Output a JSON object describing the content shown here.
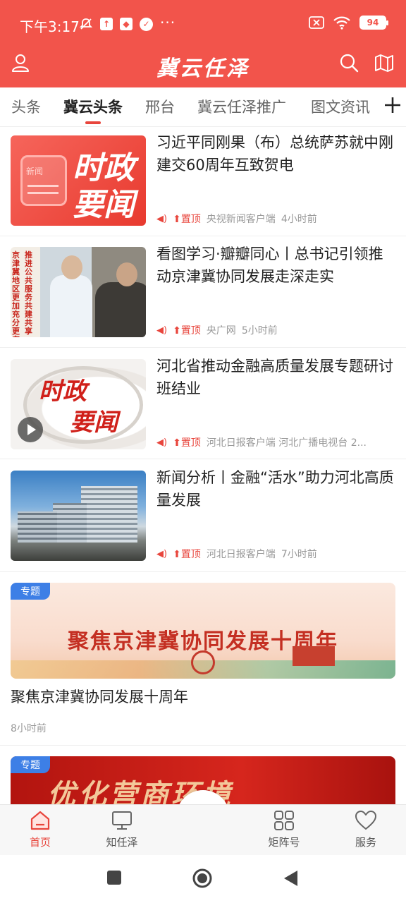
{
  "status_bar": {
    "time": "下午3:17",
    "battery": "94"
  },
  "header": {
    "title": "冀云任泽"
  },
  "tabs": [
    {
      "label": "头条"
    },
    {
      "label": "冀云头条"
    },
    {
      "label": "邢台"
    },
    {
      "label": "冀云任泽推广"
    },
    {
      "label": "图文资讯"
    }
  ],
  "news": [
    {
      "title": "习近平同刚果（布）总统萨苏就中刚建交60周年互致贺电",
      "pin": "置顶",
      "source": "央视新闻客户端",
      "time": "4小时前",
      "thumb_badge": "新闻",
      "thumb_text_1": "时政",
      "thumb_text_2": "要闻"
    },
    {
      "title": "看图学习·瓣瓣同心丨总书记引领推动京津冀协同发展走深走实",
      "pin": "置顶",
      "source": "央广网",
      "time": "5小时前",
      "thumb_side_text_1": "推进公共服务共建共享",
      "thumb_side_text_2": "京津冀地区更加充分更高"
    },
    {
      "title": "河北省推动金融高质量发展专题研讨班结业",
      "pin": "置顶",
      "source": "河北日报客户端 河北广播电视台  2...",
      "time": "",
      "thumb_text_1": "时政",
      "thumb_text_2": "要闻"
    },
    {
      "title": "新闻分析丨金融“活水”助力河北高质量发展",
      "pin": "置顶",
      "source": "河北日报客户端",
      "time": "7小时前"
    }
  ],
  "specials": [
    {
      "tag": "专题",
      "banner_text": "聚焦京津冀协同发展十周年",
      "title": "聚焦京津冀协同发展十周年",
      "time": "8小时前"
    },
    {
      "tag": "专题",
      "banner_text": "优化营商环境"
    }
  ],
  "bottom_nav": [
    {
      "label": "首页"
    },
    {
      "label": "知任泽"
    },
    {
      "label": "矩阵号"
    },
    {
      "label": "服务"
    }
  ],
  "colors": {
    "brand": "#f2544b",
    "accent": "#e8453c",
    "tag_blue": "#3d7fe6"
  }
}
